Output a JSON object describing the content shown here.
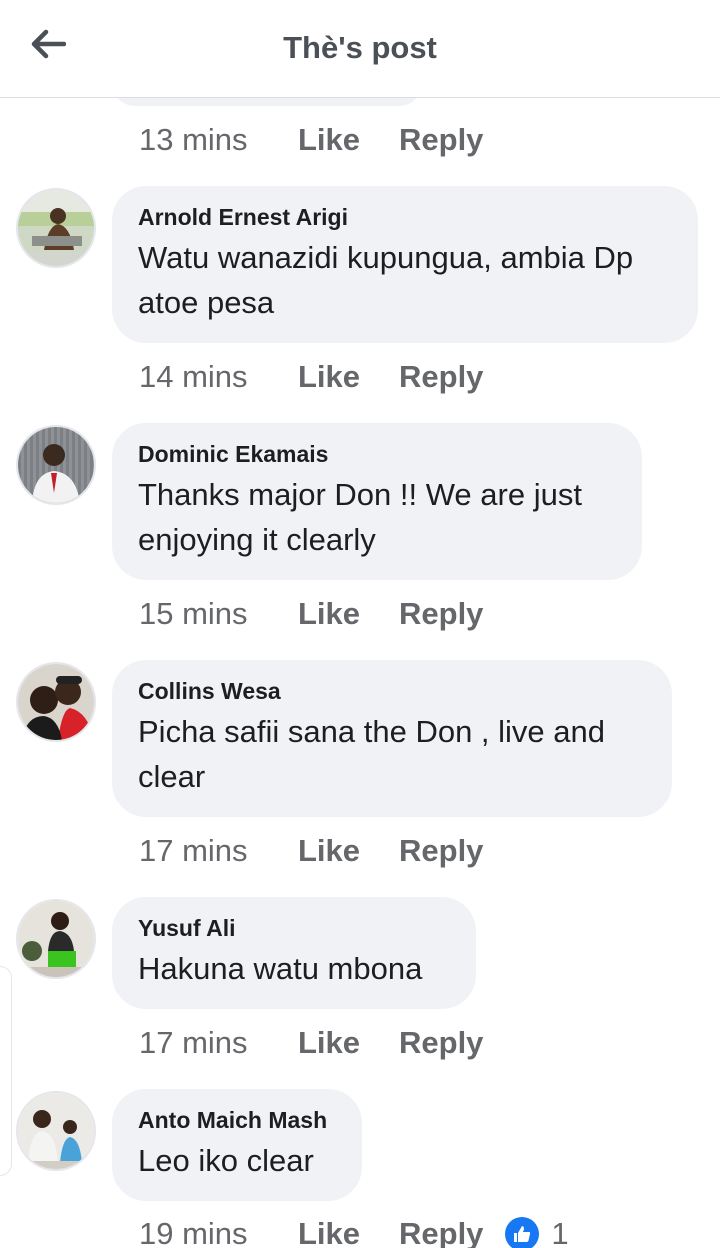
{
  "header": {
    "title": "Thè's post"
  },
  "prev_comment": {
    "time": "13 mins",
    "like_label": "Like",
    "reply_label": "Reply"
  },
  "comments": [
    {
      "author": "Arnold Ernest Arigi",
      "text": "Watu wanazidi kupungua, ambia Dp atoe pesa",
      "time": "14 mins",
      "like_label": "Like",
      "reply_label": "Reply"
    },
    {
      "author": "Dominic Ekamais",
      "text": "Thanks major Don !! We are just enjoying it clearly",
      "time": "15 mins",
      "like_label": "Like",
      "reply_label": "Reply"
    },
    {
      "author": "Collins Wesa",
      "text": "Picha safii sana the Don , live and clear",
      "time": "17 mins",
      "like_label": "Like",
      "reply_label": "Reply"
    },
    {
      "author": "Yusuf Ali",
      "text": "Hakuna watu mbona",
      "time": "17 mins",
      "like_label": "Like",
      "reply_label": "Reply"
    },
    {
      "author": "Anto Maich Mash",
      "text": "Leo iko clear",
      "time": "19 mins",
      "like_label": "Like",
      "reply_label": "Reply",
      "reaction_count": "1",
      "reaction_icon": "like-icon"
    }
  ],
  "colors": {
    "bubble": "#f0f2f5",
    "meta": "#65676b",
    "like_blue": "#1877f2"
  }
}
